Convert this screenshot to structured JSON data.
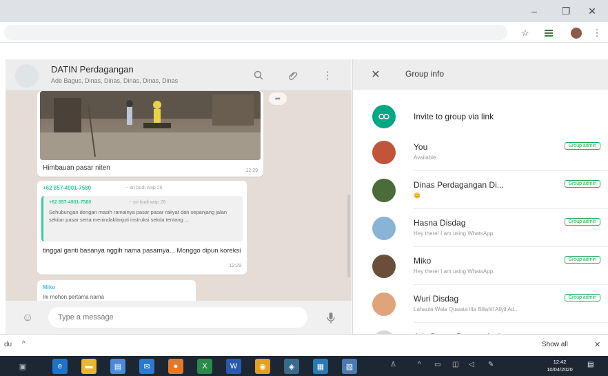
{
  "browser": {
    "window_controls": {
      "minimize": "–",
      "maximize": "❐",
      "close": "✕"
    },
    "toolbar_icons": [
      "star-icon",
      "extension-icon",
      "profile-avatar",
      "menu-icon"
    ]
  },
  "chat": {
    "title": "DATIN Perdagangan",
    "subtitle": "Ade Bagus, Dinas, Dinas, Dinas, Dinas, Dinas",
    "messages": {
      "photo_caption": "Himbauan pasar niten",
      "photo_time": "12:29",
      "reply_sender": "+62 857-4901-7580",
      "reply_sender_note": "~ ari budi wap 26",
      "quote_sender": "+62 857-4901-7580",
      "quote_note": "~ ari budi wap 26",
      "quote_text": "Sehubungan dengan masih ramainya pasar pasar rakyat dan sepanjang jalan sekitar pasar serta menindaklanjuti instruksi sekda tentang ...",
      "reply_text": "tinggal ganti basanya nggih nama pasarnya... Monggo dipun koreksi",
      "reply_time": "12:29",
      "partial_sender": "Miko",
      "partial_text": "Ini mohon pertama nama"
    },
    "composer_placeholder": "Type a message"
  },
  "group_info": {
    "title": "Group info",
    "invite_label": "Invite to group via link",
    "badge_label": "Group admin",
    "members": [
      {
        "name": "You",
        "status": "Available",
        "admin": true,
        "color": "#c0553a"
      },
      {
        "name": "Dinas Perdagangan Di...",
        "status": "😊",
        "admin": true,
        "color": "#4a6b3a"
      },
      {
        "name": "Hasna Disdag",
        "status": "Hey there! I am using WhatsApp.",
        "admin": true,
        "color": "#8ab4d6"
      },
      {
        "name": "Miko",
        "status": "Hey there! I am using WhatsApp.",
        "admin": true,
        "color": "#6b4e3a"
      },
      {
        "name": "Wuri Disdag",
        "status": "Lahaula Wala Quwata Illa Billahil Aliyil Ad...",
        "admin": true,
        "color": "#e0a47a"
      },
      {
        "name": "Ade Bagus Pranoto lusi...",
        "status": "",
        "admin": false,
        "color": "#d8d8d8"
      }
    ]
  },
  "download_bar": {
    "file_label": "du",
    "caret": "^",
    "show_all": "Show all",
    "close": "✕"
  },
  "taskbar": {
    "time": "12:42",
    "date": "10/04/2020"
  }
}
